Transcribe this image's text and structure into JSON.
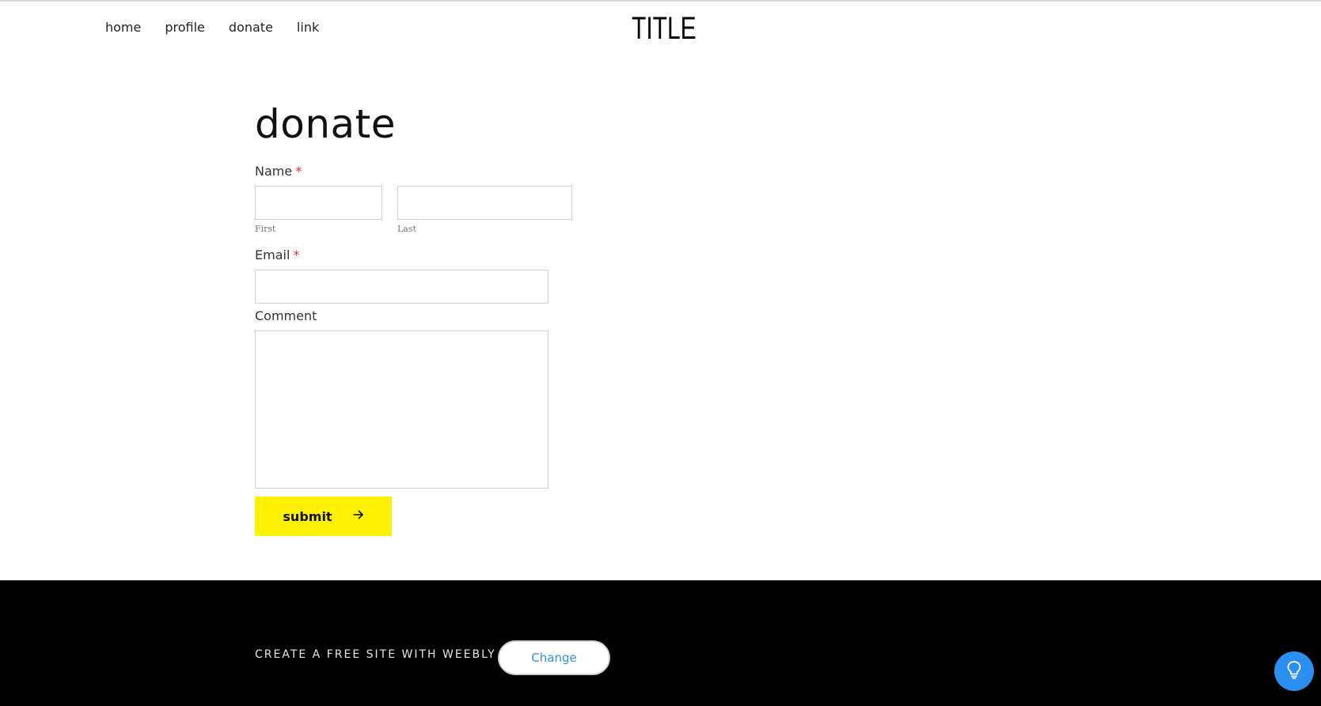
{
  "nav": {
    "items": [
      "home",
      "profile",
      "donate",
      "link"
    ]
  },
  "site": {
    "title": "TITLE"
  },
  "page": {
    "heading": "donate"
  },
  "form": {
    "name_label": "Name",
    "required_mark": "*",
    "first_label": "First",
    "last_label": "Last",
    "first_value": "",
    "last_value": "",
    "email_label": "Email",
    "email_value": "",
    "comment_label": "Comment",
    "comment_value": "",
    "submit_label": "submit",
    "submit_icon": "arrow-right-icon"
  },
  "footer": {
    "promo_text": "CREATE A FREE SITE WITH WEEBLY",
    "change_label": "Change"
  },
  "help": {
    "icon": "lightbulb-icon"
  },
  "colors": {
    "submit_bg": "#fff200",
    "required": "#e0322b",
    "link_blue": "#2f8fe0",
    "help_bg": "#2b8ff0",
    "footer_bg": "#000000"
  }
}
